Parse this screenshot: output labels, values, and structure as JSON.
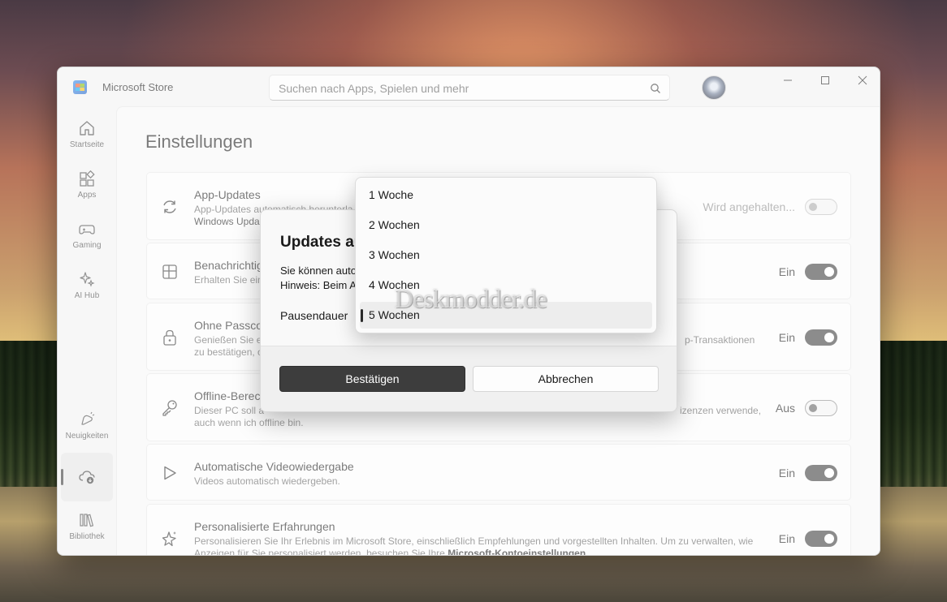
{
  "window": {
    "app_title": "Microsoft Store",
    "search_placeholder": "Suchen nach Apps, Spielen und mehr"
  },
  "sidebar": {
    "items": [
      {
        "label": "Startseite",
        "icon": "home-icon"
      },
      {
        "label": "Apps",
        "icon": "apps-icon"
      },
      {
        "label": "Gaming",
        "icon": "gamepad-icon"
      },
      {
        "label": "AI Hub",
        "icon": "ai-hub-icon"
      },
      {
        "label": "Neuigkeiten",
        "icon": "news-icon"
      },
      {
        "label": "",
        "icon": "downloads-icon"
      },
      {
        "label": "Bibliothek",
        "icon": "library-icon"
      }
    ]
  },
  "page": {
    "title": "Einstellungen"
  },
  "settings": [
    {
      "title": "App-Updates",
      "desc1": "App-Updates automatisch herunterla",
      "desc2": "Windows Upda",
      "state": "Wird angehalten...",
      "toggle": "off-disabled",
      "icon": "refresh-icon"
    },
    {
      "title": "Benachrichtig",
      "desc1": "Erhalten Sie ein",
      "state": "Ein",
      "toggle": "on",
      "icon": "notification-icon"
    },
    {
      "title": "Ohne Passcod",
      "desc1": "Genießen Sie ei",
      "desc1_right": "p-Transaktionen",
      "desc2": "zu bestätigen, o",
      "state": "Ein",
      "toggle": "on",
      "icon": "lock-icon"
    },
    {
      "title": "Offline-Berec",
      "desc1": "Dieser PC soll a",
      "desc1_right": "izenzen verwende,",
      "desc2": "auch wenn ich offline bin.",
      "state": "Aus",
      "toggle": "off",
      "icon": "key-icon"
    },
    {
      "title": "Automatische Videowiedergabe",
      "desc1": "Videos automatisch wiedergeben.",
      "state": "Ein",
      "toggle": "on",
      "icon": "play-icon"
    },
    {
      "title": "Personalisierte Erfahrungen",
      "desc1": "Personalisieren Sie Ihr Erlebnis im Microsoft Store, einschließlich Empfehlungen und vorgestellten Inhalten. Um zu verwalten, wie",
      "desc2": "Anzeigen für Sie personalisiert werden, besuchen Sie Ihre ",
      "desc2_link": "Microsoft-Kontoeinstellungen",
      "desc2_end": ".",
      "state": "Ein",
      "toggle": "on",
      "icon": "sparkle-icon"
    }
  ],
  "dialog": {
    "title": "Updates au",
    "text1": "Sie können auto",
    "text2": "Hinweis: Beim A",
    "label": "Pausendauer",
    "confirm_label": "Bestätigen",
    "cancel_label": "Abbrechen"
  },
  "dropdown": {
    "options": [
      "1 Woche",
      "2 Wochen",
      "3 Wochen",
      "4 Wochen",
      "5 Wochen"
    ],
    "selected": "5 Wochen"
  },
  "watermark": "Deskmodder.de"
}
